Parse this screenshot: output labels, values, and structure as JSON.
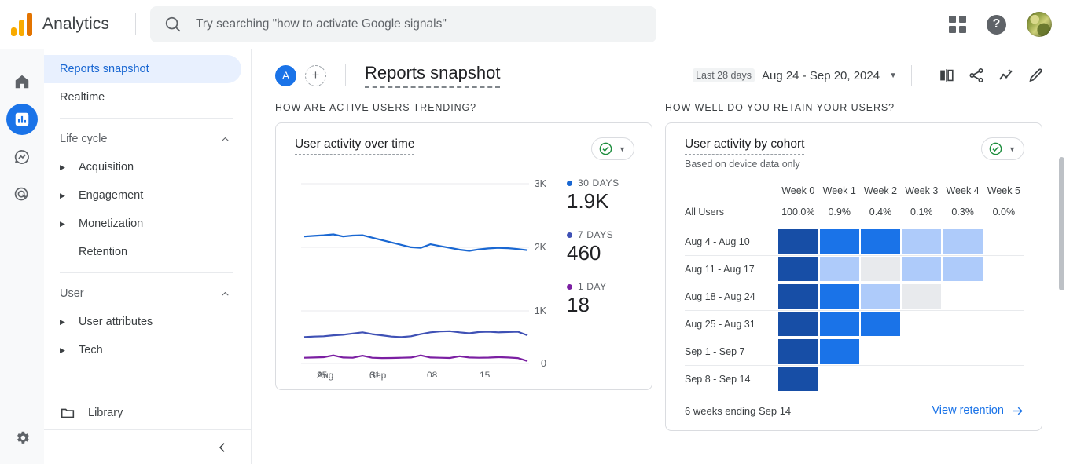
{
  "header": {
    "brand": "Analytics",
    "search_placeholder": "Try searching \"how to activate Google signals\"",
    "apps_label": "Google apps",
    "help_label": "?",
    "avatar_label": "Account"
  },
  "rail": {
    "items": [
      {
        "name": "home-icon",
        "label": "Home"
      },
      {
        "name": "reports-icon",
        "label": "Reports"
      },
      {
        "name": "explore-icon",
        "label": "Explore"
      },
      {
        "name": "advertising-icon",
        "label": "Advertising"
      }
    ],
    "settings_label": "Admin"
  },
  "sidebar": {
    "reports_snapshot": "Reports snapshot",
    "realtime": "Realtime",
    "life_cycle": {
      "label": "Life cycle",
      "children": [
        "Acquisition",
        "Engagement",
        "Monetization"
      ],
      "leaf": "Retention"
    },
    "user": {
      "label": "User",
      "children": [
        "User attributes",
        "Tech"
      ]
    },
    "library": "Library"
  },
  "page": {
    "avatar_initial": "A",
    "add_label": "+",
    "title": "Reports snapshot",
    "date_prefix": "Last 28 days",
    "date_range": "Aug 24 - Sep 20, 2024",
    "tools": [
      "compare-icon",
      "share-icon",
      "insights-icon",
      "edit-icon"
    ]
  },
  "left_card": {
    "section_heading": "HOW ARE ACTIVE USERS TRENDING?",
    "title": "User activity over time",
    "badge": "data-quality-ok"
  },
  "right_card": {
    "section_heading": "HOW WELL DO YOU RETAIN YOUR USERS?",
    "title": "User activity by cohort",
    "subtitle": "Based on device data only",
    "badge": "data-quality-ok",
    "footer_note": "6 weeks ending Sep 14",
    "footer_link": "View retention"
  },
  "colors": {
    "accent": "#1a73e8",
    "series_30d": "#1967d2",
    "series_7d": "#3f51b5",
    "series_1d": "#7b1fa2",
    "heat_dark": "#174ea6",
    "heat_mid": "#1a73e8",
    "heat_light": "#aecbfa",
    "heat_none": "#e8eaed",
    "ok_green": "#1e8e3e"
  },
  "chart_data": {
    "type": "line",
    "title": "User activity over time",
    "xlabel": "",
    "ylabel": "",
    "ylim": [
      0,
      3000
    ],
    "yticks": [
      0,
      1000,
      2000,
      3000
    ],
    "ytick_labels": [
      "0",
      "1K",
      "2K",
      "3K"
    ],
    "grid": true,
    "legend_position": "right",
    "x_tick_labels": [
      {
        "day": "25",
        "month": "Aug"
      },
      {
        "day": "01",
        "month": "Sep"
      },
      {
        "day": "08",
        "month": ""
      },
      {
        "day": "15",
        "month": ""
      }
    ],
    "series": [
      {
        "name": "30 DAYS",
        "color": "#1967d2",
        "display_value": "1.9K",
        "values": [
          2120,
          2130,
          2140,
          2155,
          2120,
          2135,
          2140,
          2100,
          2060,
          2020,
          1980,
          1940,
          1930,
          1990,
          1960,
          1930,
          1900,
          1880,
          1905,
          1920,
          1930,
          1925,
          1910,
          1890
        ]
      },
      {
        "name": "7 DAYS",
        "color": "#3f51b5",
        "display_value": "460",
        "values": [
          440,
          450,
          455,
          470,
          480,
          500,
          520,
          490,
          470,
          450,
          440,
          455,
          490,
          520,
          535,
          540,
          520,
          505,
          525,
          530,
          520,
          525,
          530,
          470
        ]
      },
      {
        "name": "1 DAY",
        "color": "#7b1fa2",
        "display_value": "18",
        "values": [
          95,
          100,
          105,
          135,
          100,
          95,
          130,
          95,
          90,
          92,
          95,
          100,
          135,
          100,
          95,
          92,
          120,
          100,
          95,
          98,
          105,
          100,
          90,
          40
        ]
      }
    ]
  },
  "cohort_data": {
    "type": "heatmap",
    "column_headers": [
      "Week 0",
      "Week 1",
      "Week 2",
      "Week 3",
      "Week 4",
      "Week 5"
    ],
    "all_users_label": "All Users",
    "all_users_values": [
      "100.0%",
      "0.9%",
      "0.4%",
      "0.1%",
      "0.3%",
      "0.0%"
    ],
    "rows": [
      {
        "label": "Aug 4 - Aug 10",
        "cells": [
          "dark",
          "mid",
          "mid",
          "light",
          "light",
          "empty"
        ]
      },
      {
        "label": "Aug 11 - Aug 17",
        "cells": [
          "dark",
          "light",
          "none",
          "light",
          "light",
          "empty"
        ]
      },
      {
        "label": "Aug 18 - Aug 24",
        "cells": [
          "dark",
          "mid",
          "light",
          "none",
          "empty",
          "empty"
        ]
      },
      {
        "label": "Aug 25 - Aug 31",
        "cells": [
          "dark",
          "mid",
          "mid",
          "empty",
          "empty",
          "empty"
        ]
      },
      {
        "label": "Sep 1 - Sep 7",
        "cells": [
          "dark",
          "mid",
          "empty",
          "empty",
          "empty",
          "empty"
        ]
      },
      {
        "label": "Sep 8 - Sep 14",
        "cells": [
          "dark",
          "empty",
          "empty",
          "empty",
          "empty",
          "empty"
        ]
      }
    ]
  }
}
